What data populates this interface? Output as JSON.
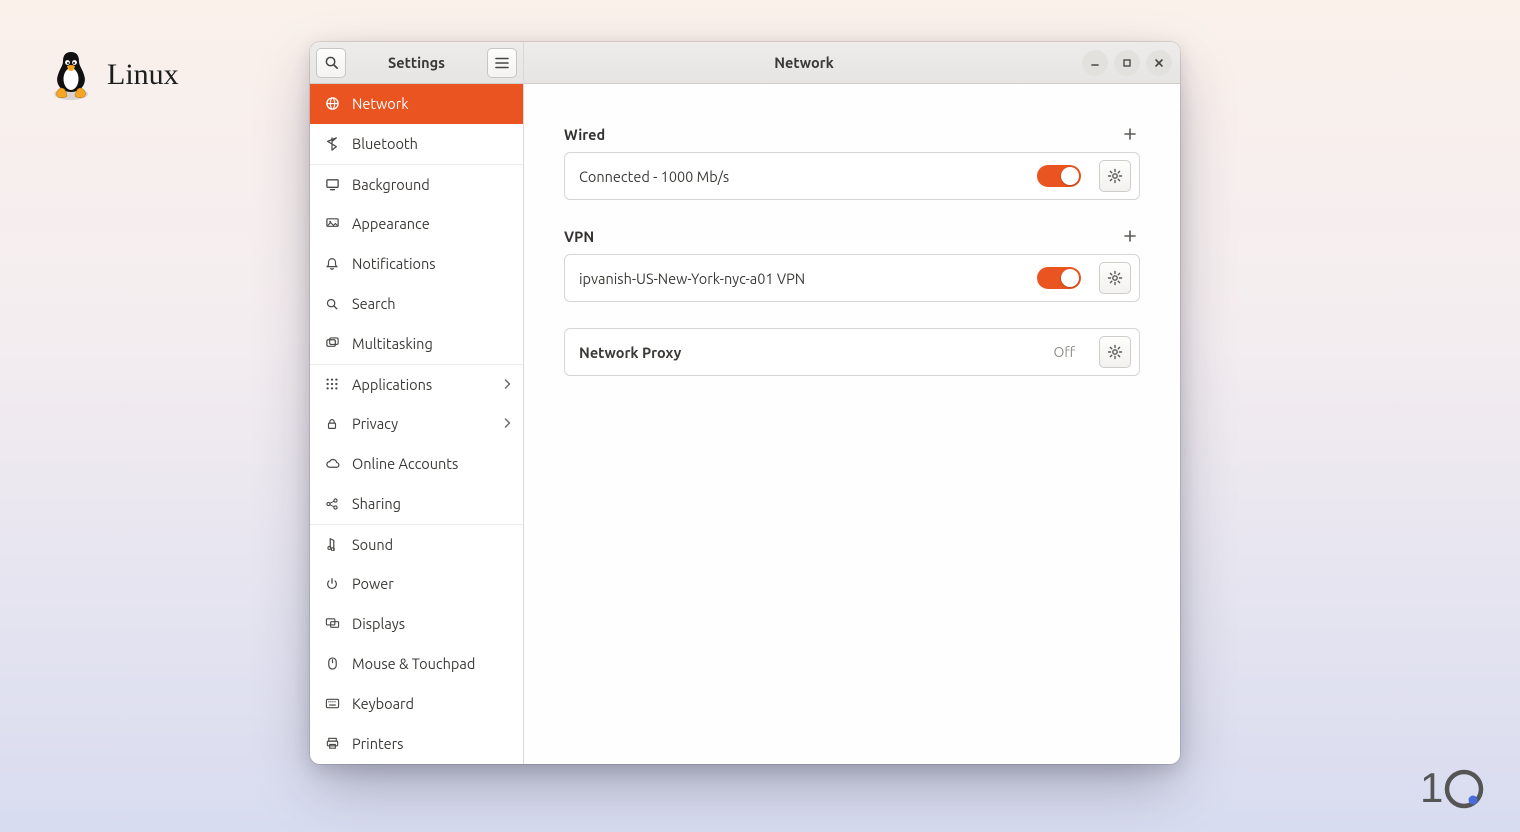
{
  "branding": {
    "wordmark": "Linux"
  },
  "window": {
    "sidebar_title": "Settings",
    "main_title": "Network"
  },
  "sidebar": {
    "items": [
      {
        "label": "Network",
        "icon": "globe",
        "active": true
      },
      {
        "label": "Bluetooth",
        "icon": "bluetooth"
      },
      {
        "label": "Background",
        "icon": "monitor",
        "sep": true
      },
      {
        "label": "Appearance",
        "icon": "appearance"
      },
      {
        "label": "Notifications",
        "icon": "bell"
      },
      {
        "label": "Search",
        "icon": "search"
      },
      {
        "label": "Multitasking",
        "icon": "multitask"
      },
      {
        "label": "Applications",
        "icon": "grid",
        "chev": true,
        "sep": true
      },
      {
        "label": "Privacy",
        "icon": "lock",
        "chev": true
      },
      {
        "label": "Online Accounts",
        "icon": "cloud"
      },
      {
        "label": "Sharing",
        "icon": "share"
      },
      {
        "label": "Sound",
        "icon": "sound",
        "sep": true
      },
      {
        "label": "Power",
        "icon": "power"
      },
      {
        "label": "Displays",
        "icon": "displays"
      },
      {
        "label": "Mouse & Touchpad",
        "icon": "mouse"
      },
      {
        "label": "Keyboard",
        "icon": "keyboard"
      },
      {
        "label": "Printers",
        "icon": "printer"
      }
    ]
  },
  "sections": {
    "wired": {
      "title": "Wired",
      "rows": [
        {
          "label": "Connected - 1000 Mb/s",
          "toggle_on": true,
          "gear": true
        }
      ]
    },
    "vpn": {
      "title": "VPN",
      "rows": [
        {
          "label": "ipvanish-US-New-York-nyc-a01 VPN",
          "toggle_on": true,
          "gear": true
        }
      ]
    },
    "proxy": {
      "label": "Network Proxy",
      "status": "Off"
    }
  },
  "colors": {
    "accent": "#e95420"
  }
}
